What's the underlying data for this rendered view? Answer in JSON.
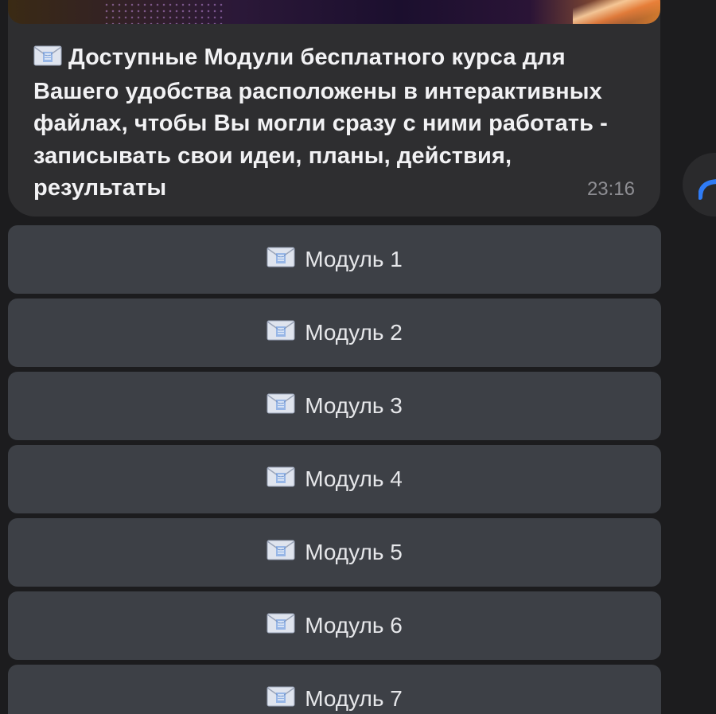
{
  "message": {
    "text": "Доступные Модули бесплатного курса для Вашего удобства расположены в интерактивных файлах, чтобы Вы могли сразу с ними работать - записывать свои идеи, планы, действия, результаты",
    "time": "23:16",
    "icon": "envelope-icon"
  },
  "keyboard": {
    "buttons": [
      {
        "label": "Модуль 1",
        "icon": "envelope-icon"
      },
      {
        "label": "Модуль 2",
        "icon": "envelope-icon"
      },
      {
        "label": "Модуль 3",
        "icon": "envelope-icon"
      },
      {
        "label": "Модуль 4",
        "icon": "envelope-icon"
      },
      {
        "label": "Модуль 5",
        "icon": "envelope-icon"
      },
      {
        "label": "Модуль 6",
        "icon": "envelope-icon"
      },
      {
        "label": "Модуль 7",
        "icon": "envelope-icon"
      }
    ]
  },
  "colors": {
    "background": "#1c1c1e",
    "bubble": "#2e2e30",
    "button": "#3d4046",
    "accent": "#2f7cf6"
  }
}
